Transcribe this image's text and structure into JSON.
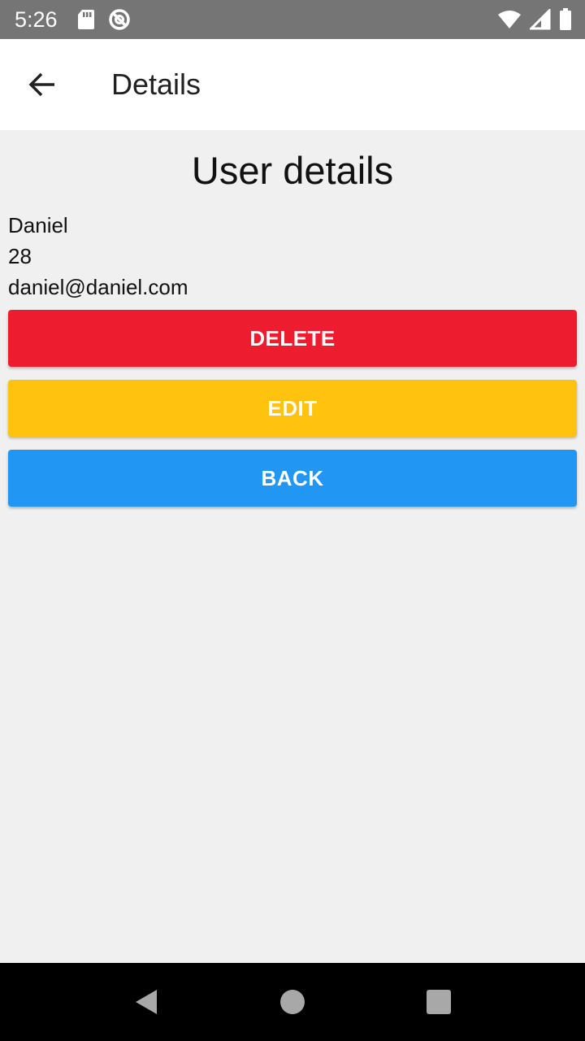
{
  "status_bar": {
    "time": "5:26",
    "icons": [
      "sd-card-icon",
      "no-disturb-icon",
      "wifi-icon",
      "signal-icon",
      "battery-icon"
    ]
  },
  "app_bar": {
    "title": "Details",
    "back_icon": "arrow-back-icon"
  },
  "main": {
    "heading": "User details",
    "user": {
      "name": "Daniel",
      "age": "28",
      "email": "daniel@daniel.com"
    },
    "buttons": {
      "delete": "DELETE",
      "edit": "EDIT",
      "back": "BACK"
    }
  },
  "colors": {
    "delete": "#ED1C2E",
    "edit": "#FFC20E",
    "back": "#2196F3",
    "status_bar": "#757575",
    "background": "#F0F0F0"
  },
  "nav_bar": {
    "icons": [
      "nav-back-icon",
      "nav-home-icon",
      "nav-recents-icon"
    ]
  }
}
